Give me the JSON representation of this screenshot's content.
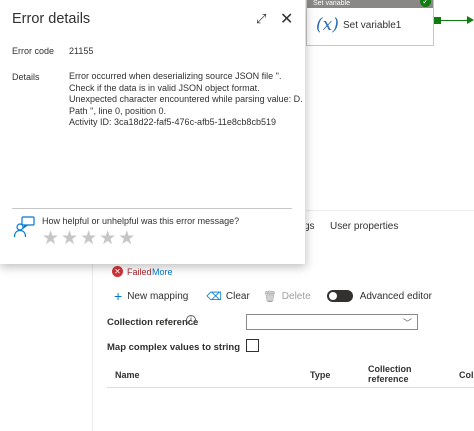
{
  "canvas": {
    "activity": {
      "header": "Set variable",
      "name": "Set variable1",
      "icon": "variable-x-icon"
    }
  },
  "tabs": [
    {
      "label": "gs"
    },
    {
      "label": "User properties"
    }
  ],
  "status": {
    "text": "Failed",
    "more": "More",
    "color": "#d13438"
  },
  "toolbar": {
    "new_mapping": "New mapping",
    "clear": "Clear",
    "delete": "Delete",
    "advanced_editor": "Advanced editor",
    "advanced_editor_on": true
  },
  "form": {
    "collection_reference_label": "Collection reference",
    "collection_reference_value": "",
    "map_complex_label": "Map complex values to string",
    "map_complex_checked": false
  },
  "table": {
    "columns": [
      "Name",
      "Type",
      "Collection reference",
      "Col"
    ]
  },
  "error_dialog": {
    "title": "Error details",
    "code_label": "Error code",
    "code_value": "21155",
    "details_label": "Details",
    "details_lines": [
      "Error occurred when deserializing source JSON file ''.",
      "Check if the data is in valid JSON object format.",
      "Unexpected character encountered while parsing value: D.",
      "Path '', line 0, position 0.",
      "Activity ID: 3ca18d22-faf5-476c-afb5-11e8cb8cb519"
    ],
    "feedback_question": "How helpful or unhelpful was this error message?",
    "rating_max": 5,
    "rating_value": 0
  },
  "colors": {
    "accent": "#0078d4",
    "success": "#107c10",
    "error": "#d13438"
  }
}
